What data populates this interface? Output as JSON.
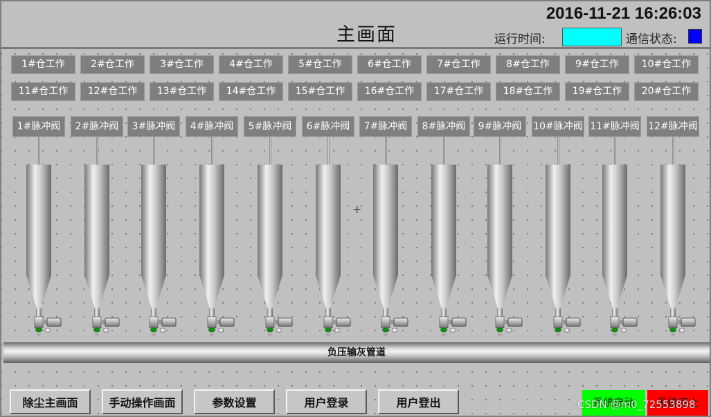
{
  "header": {
    "title": "主画面",
    "datetime": "2016-11-21 16:26:03",
    "runtime_label": "运行时间:",
    "comm_label": "通信状态:",
    "runtime_color": "#00ffff",
    "comm_color": "#0000ff"
  },
  "bins_row1": [
    "1#仓工作",
    "2#仓工作",
    "3#仓工作",
    "4#仓工作",
    "5#仓工作",
    "6#仓工作",
    "7#仓工作",
    "8#仓工作",
    "9#仓工作",
    "10#仓工作"
  ],
  "bins_row2": [
    "11#仓工作",
    "12#仓工作",
    "13#仓工作",
    "14#仓工作",
    "15#仓工作",
    "16#仓工作",
    "17#仓工作",
    "18#仓工作",
    "19#仓工作",
    "20#仓工作"
  ],
  "valves": [
    "1#脉冲阀",
    "2#脉冲阀",
    "3#脉冲阀",
    "4#脉冲阀",
    "5#脉冲阀",
    "6#脉冲阀",
    "7#脉冲阀",
    "8#脉冲阀",
    "9#脉冲阀",
    "10#脉冲阀",
    "11#脉冲阀",
    "12#脉冲阀"
  ],
  "pipe": {
    "label": "负压输灰管道"
  },
  "crosshair": "+",
  "nav": {
    "dust_main": "除尘主画面",
    "manual": "手动操作画面",
    "params": "参数设置",
    "login": "用户登录",
    "logout": "用户登出"
  },
  "controls": {
    "start": "系统启动",
    "stop": "系统停止",
    "start_color": "#00ff00",
    "stop_color": "#ff0000"
  },
  "watermark": "CSDN @m0_72553898"
}
